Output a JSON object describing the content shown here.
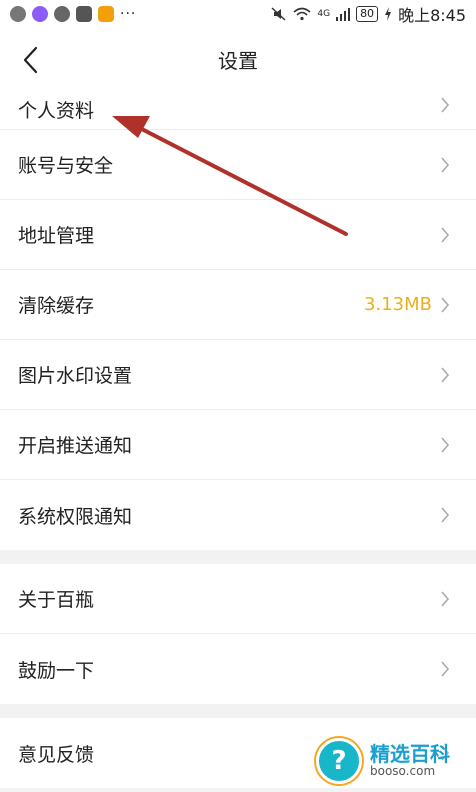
{
  "status_bar": {
    "more": "···",
    "battery": "80",
    "time": "晚上8:45",
    "signal": "4G"
  },
  "header": {
    "title": "设置"
  },
  "groups": [
    {
      "items": [
        {
          "label": "个人资料"
        },
        {
          "label": "账号与安全"
        },
        {
          "label": "地址管理"
        },
        {
          "label": "清除缓存",
          "value": "3.13MB"
        },
        {
          "label": "图片水印设置"
        },
        {
          "label": "开启推送通知"
        },
        {
          "label": "系统权限通知"
        }
      ]
    },
    {
      "items": [
        {
          "label": "关于百瓶"
        },
        {
          "label": "鼓励一下"
        }
      ]
    },
    {
      "items": [
        {
          "label": "意见反馈"
        }
      ]
    }
  ],
  "colors": {
    "accent_value": "#e8b020",
    "arrow": "#b0302a",
    "background": "#f2f2f2"
  },
  "watermark": {
    "title": "精选百科",
    "url": "booso.com",
    "symbol": "?"
  }
}
